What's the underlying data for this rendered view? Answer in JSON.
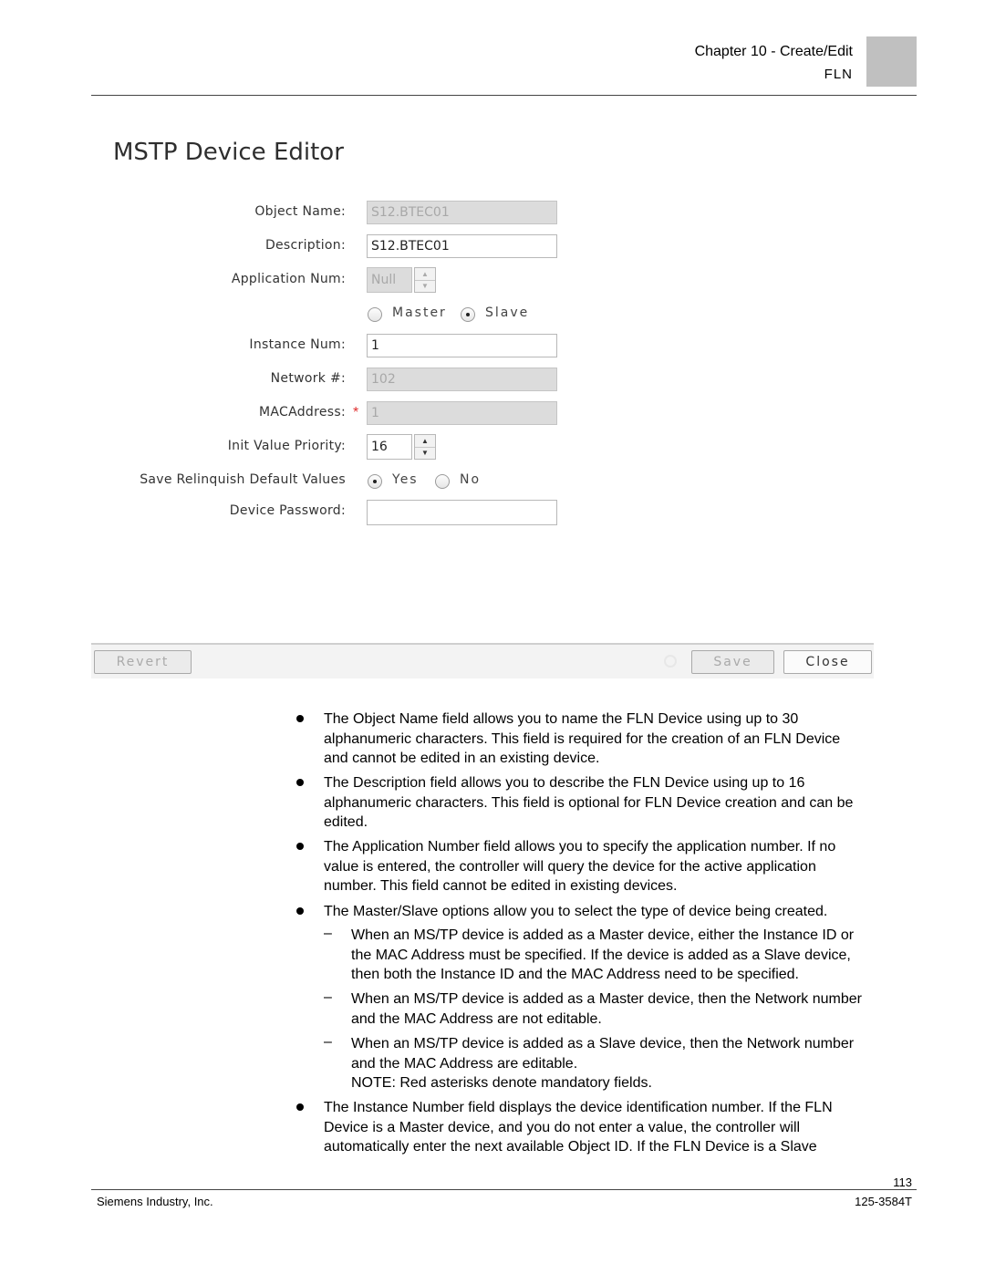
{
  "header": {
    "chapter": "Chapter 10 - Create/Edit",
    "section": "FLN"
  },
  "editor": {
    "title": "MSTP Device Editor",
    "fields": {
      "object_name": {
        "label": "Object Name:",
        "value": "S12.BTEC01",
        "disabled": true
      },
      "description": {
        "label": "Description:",
        "value": "S12.BTEC01",
        "disabled": false
      },
      "application_num": {
        "label": "Application Num:",
        "value": "Null",
        "disabled": true
      },
      "device_type": {
        "options": [
          "Master",
          "Slave"
        ],
        "selected": "Slave"
      },
      "instance_num": {
        "label": "Instance Num:",
        "value": "1",
        "disabled": false
      },
      "network_num": {
        "label": "Network #:",
        "value": "102",
        "disabled": true
      },
      "mac_address": {
        "label": "MACAddress:",
        "required_marker": "*",
        "value": "1",
        "disabled": true
      },
      "init_value_priority": {
        "label": "Init Value Priority:",
        "value": "16",
        "disabled": false
      },
      "save_relinquish": {
        "label": "Save Relinquish Default Values",
        "options": [
          "Yes",
          "No"
        ],
        "selected": "Yes"
      },
      "device_password": {
        "label": "Device Password:",
        "value": ""
      }
    },
    "buttons": {
      "revert": "Revert",
      "save": "Save",
      "close": "Close"
    }
  },
  "body": {
    "bullets": [
      {
        "pre": "The ",
        "term": "Object Name",
        "lines": [
          " field allows you to name the FLN Device using up to 30",
          "alphanumeric characters. This field is required for the creation of an FLN Device",
          "and cannot be edited in an existing device."
        ]
      },
      {
        "pre": "The ",
        "term": "Description",
        "lines": [
          " field allows you to describe the FLN Device using up to 16",
          "alphanumeric characters. This field is optional for FLN Device creation and can be",
          "edited."
        ]
      },
      {
        "pre": "The ",
        "term": "Application Number",
        "lines": [
          " field allows you to specify the application number. If no",
          "value is entered, the controller will query the device for the active application",
          "number. This field cannot be edited in existing devices."
        ]
      },
      {
        "pre": "The ",
        "term": "Master/Slave",
        "lines": [
          " options allow you to select the type of device being created."
        ]
      },
      {
        "pre": "The ",
        "term": "Instance Number",
        "lines": [
          " field displays the device identification number. If the FLN",
          "Device is a Master device, and you do not enter a value, the controller will",
          "automatically enter the next available Object ID. If the FLN Device is a Slave"
        ]
      }
    ],
    "subitems": [
      {
        "dash": "–",
        "lines": [
          "When an MS/TP device is added as a Master device, either the Instance ID or",
          "the MAC Address must be specified. If the device is added as a Slave device,",
          "then both the Instance ID and the MAC Address need to be specified."
        ]
      },
      {
        "dash": "–",
        "lines": [
          "When an MS/TP device is added as a Master device, then the Network number",
          "and the MAC Address are not editable."
        ]
      },
      {
        "dash": "–",
        "lines": [
          "When an MS/TP device is added as a Slave device, then the Network number",
          "and the MAC Address are editable."
        ]
      }
    ],
    "note": {
      "label": "NOTE:",
      "text": " Red asterisks denote mandatory fields."
    }
  },
  "footer": {
    "page_number": "113",
    "company": "Siemens Industry, Inc.",
    "doc_number": "125-3584T"
  }
}
